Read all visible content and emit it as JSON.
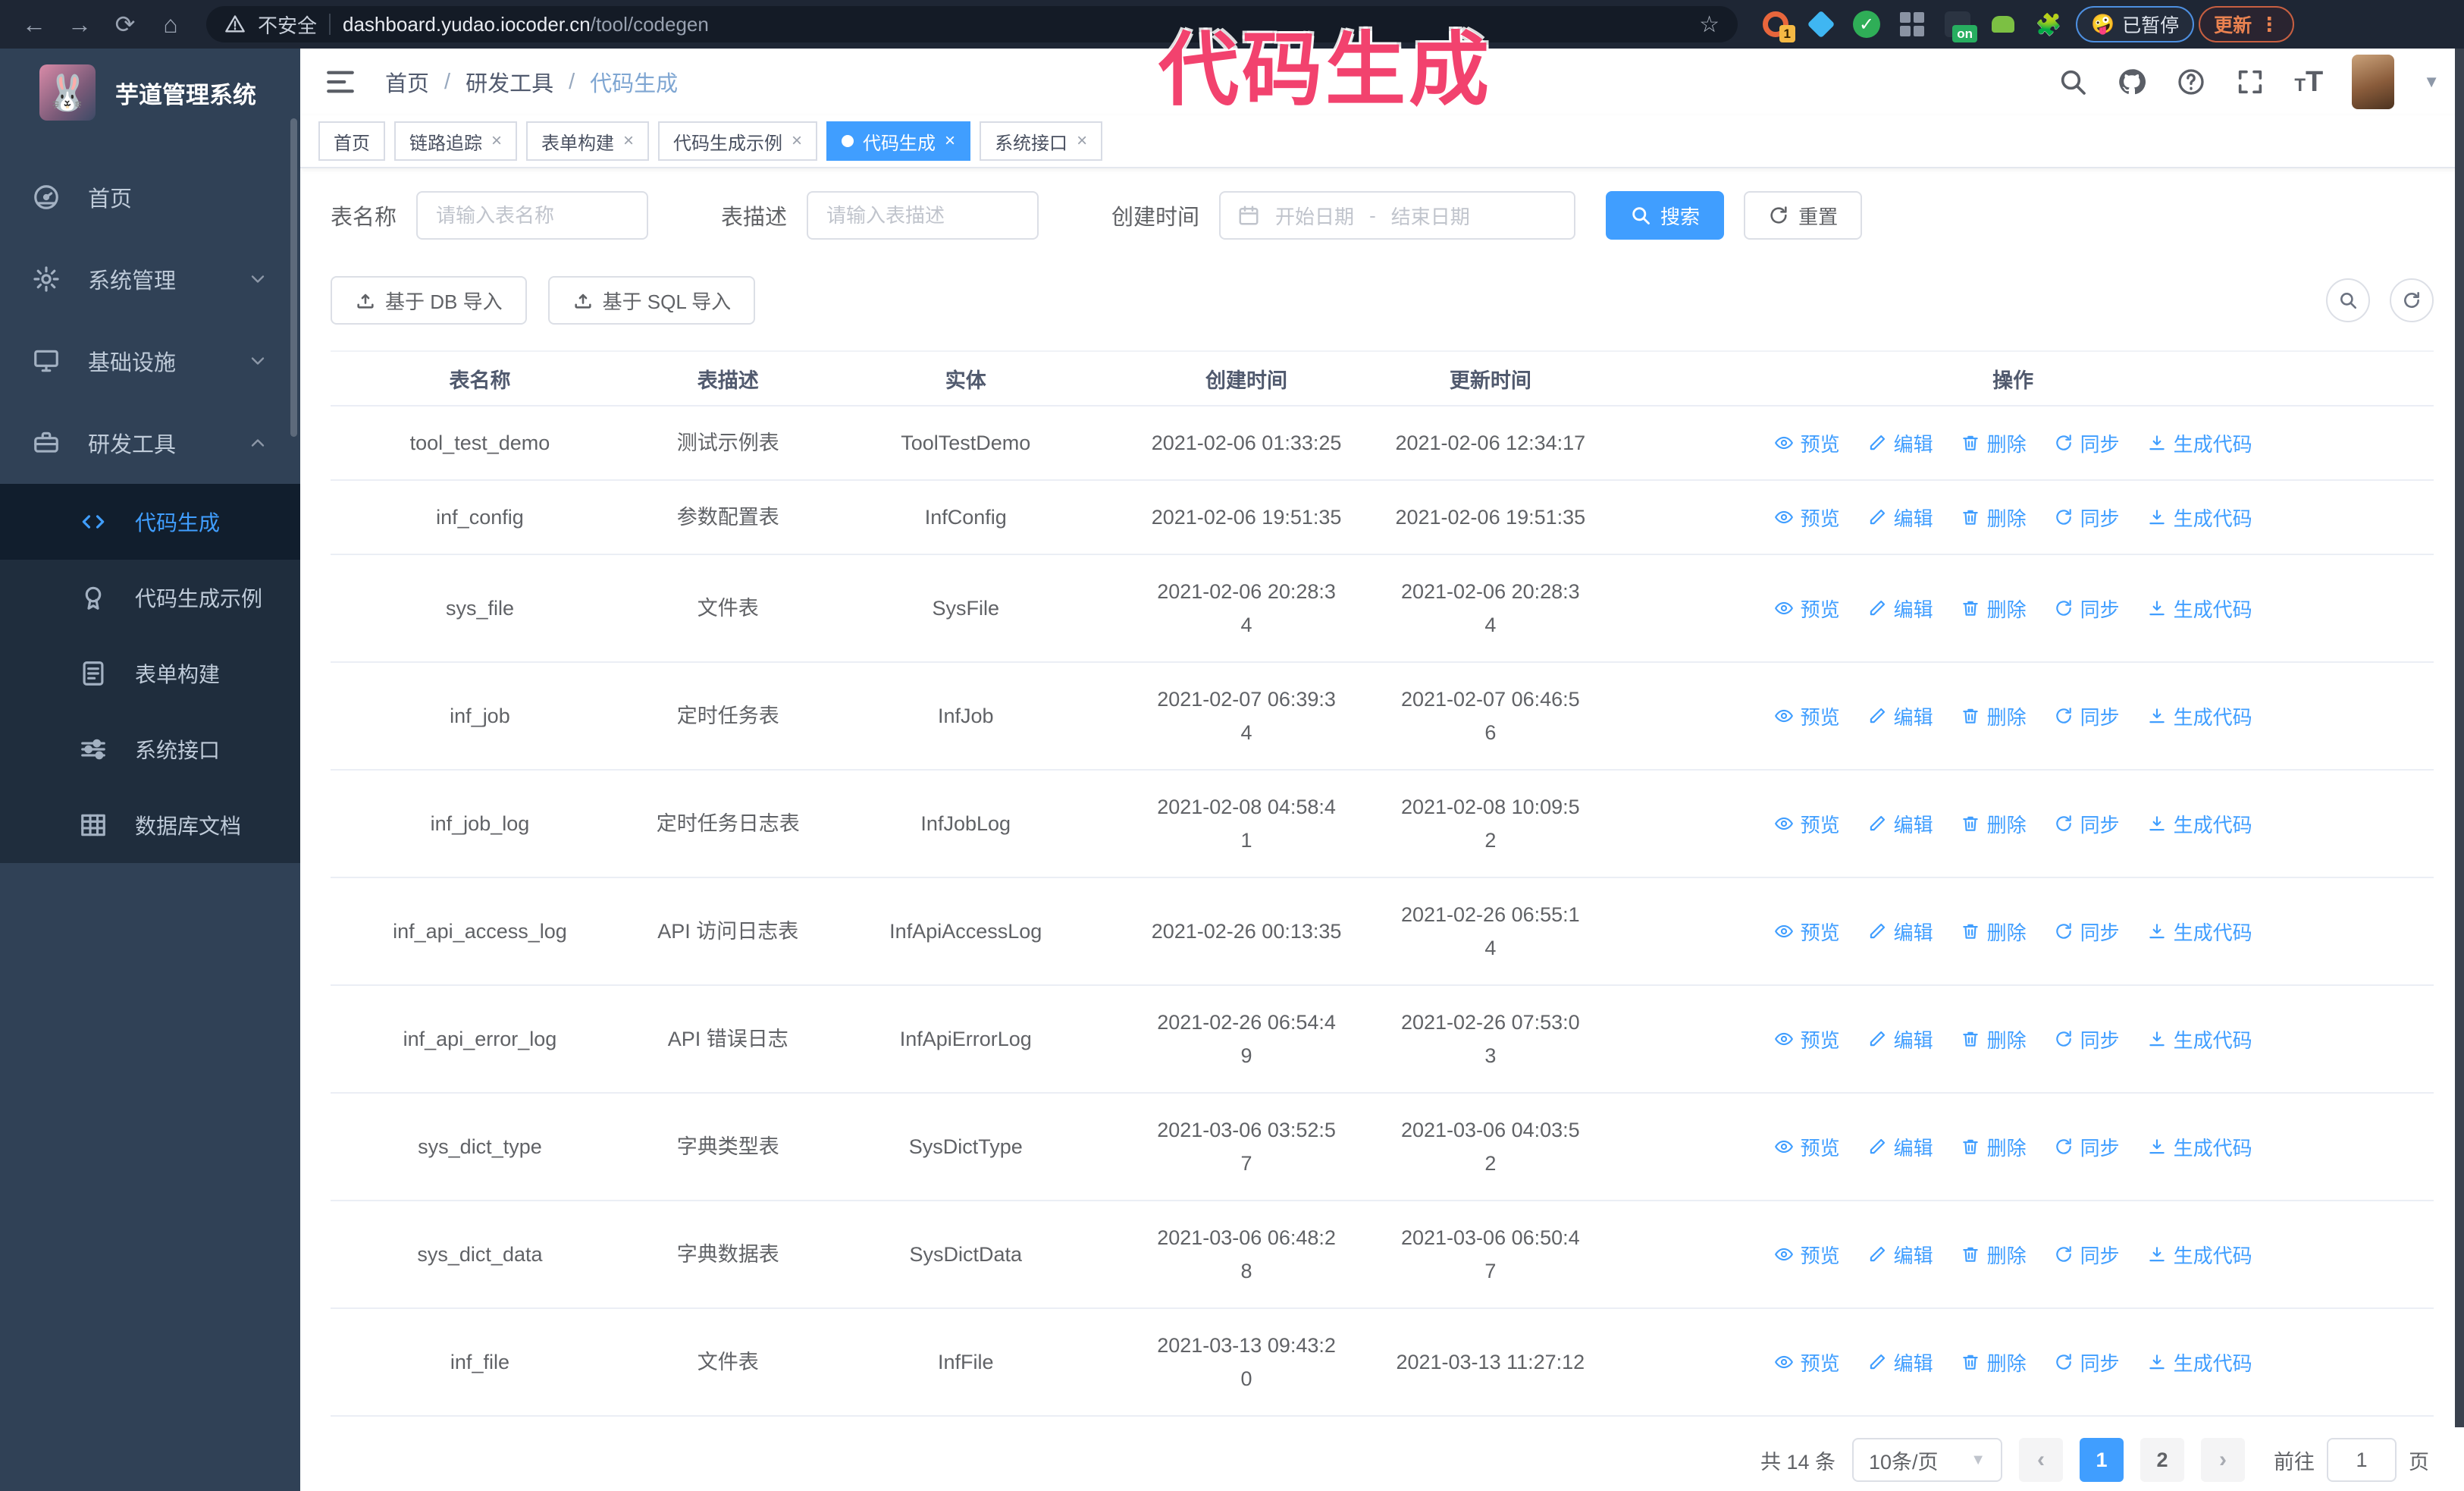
{
  "colors": {
    "accent": "#409EFF",
    "sidebar_bg": "#304156",
    "submenu_bg": "#1f2d3d",
    "chrome_bg": "#1e2634",
    "annotation_pink": "#f2426e",
    "active_tab_bg": "#409EFF"
  },
  "annotation_text": "代码生成",
  "browser": {
    "security_label": "不安全",
    "url_host": "dashboard.yudao.iocoder.cn",
    "url_path": "/tool/codegen",
    "extension_badge_count": "1",
    "extension_on_badge": "on",
    "paused_chip": "已暂停",
    "paused_emoji": "🤪",
    "update_chip": "更新",
    "update_dots": "⋮"
  },
  "sidebar": {
    "title": "芋道管理系统",
    "logo_emoji": "🐰",
    "items": [
      {
        "label": "首页",
        "icon": "home-icon",
        "group": false
      },
      {
        "label": "系统管理",
        "icon": "gear-icon",
        "group": true,
        "chevron": "down"
      },
      {
        "label": "基础设施",
        "icon": "infra-icon",
        "group": true,
        "chevron": "down"
      },
      {
        "label": "研发工具",
        "icon": "tools-icon",
        "group": true,
        "chevron": "up",
        "children": [
          {
            "label": "代码生成",
            "icon": "code-icon",
            "active": true
          },
          {
            "label": "代码生成示例",
            "icon": "example-icon",
            "active": false
          },
          {
            "label": "表单构建",
            "icon": "form-icon",
            "active": false
          },
          {
            "label": "系统接口",
            "icon": "api-icon",
            "active": false
          },
          {
            "label": "数据库文档",
            "icon": "dbdoc-icon",
            "active": false
          }
        ]
      }
    ]
  },
  "breadcrumb": [
    "首页",
    "研发工具",
    "代码生成"
  ],
  "tabs": [
    {
      "label": "首页",
      "closable": false,
      "active": false
    },
    {
      "label": "链路追踪",
      "closable": true,
      "active": false
    },
    {
      "label": "表单构建",
      "closable": true,
      "active": false
    },
    {
      "label": "代码生成示例",
      "closable": true,
      "active": false
    },
    {
      "label": "代码生成",
      "closable": true,
      "active": true
    },
    {
      "label": "系统接口",
      "closable": true,
      "active": false
    }
  ],
  "filters": {
    "name_label": "表名称",
    "name_placeholder": "请输入表名称",
    "desc_label": "表描述",
    "desc_placeholder": "请输入表描述",
    "time_label": "创建时间",
    "start_placeholder": "开始日期",
    "range_separator": "-",
    "end_placeholder": "结束日期",
    "search_label": "搜索",
    "reset_label": "重置"
  },
  "toolbar": {
    "import_db_label": "基于 DB 导入",
    "import_sql_label": "基于 SQL 导入"
  },
  "table": {
    "columns": [
      "表名称",
      "表描述",
      "实体",
      "创建时间",
      "更新时间",
      "操作"
    ],
    "actions": [
      "预览",
      "编辑",
      "删除",
      "同步",
      "生成代码"
    ],
    "rows": [
      {
        "name": "tool_test_demo",
        "desc": "测试示例表",
        "entity": "ToolTestDemo",
        "created": [
          "2021-02-06 01:33:25"
        ],
        "updated": [
          "2021-02-06 12:34:17"
        ]
      },
      {
        "name": "inf_config",
        "desc": "参数配置表",
        "entity": "InfConfig",
        "created": [
          "2021-02-06 19:51:35"
        ],
        "updated": [
          "2021-02-06 19:51:35"
        ]
      },
      {
        "name": "sys_file",
        "desc": "文件表",
        "entity": "SysFile",
        "created": [
          "2021-02-06 20:28:3",
          "4"
        ],
        "updated": [
          "2021-02-06 20:28:3",
          "4"
        ]
      },
      {
        "name": "inf_job",
        "desc": "定时任务表",
        "entity": "InfJob",
        "created": [
          "2021-02-07 06:39:3",
          "4"
        ],
        "updated": [
          "2021-02-07 06:46:5",
          "6"
        ]
      },
      {
        "name": "inf_job_log",
        "desc": "定时任务日志表",
        "entity": "InfJobLog",
        "created": [
          "2021-02-08 04:58:4",
          "1"
        ],
        "updated": [
          "2021-02-08 10:09:5",
          "2"
        ]
      },
      {
        "name": "inf_api_access_log",
        "desc": "API 访问日志表",
        "entity": "InfApiAccessLog",
        "created": [
          "2021-02-26 00:13:35"
        ],
        "updated": [
          "2021-02-26 06:55:1",
          "4"
        ]
      },
      {
        "name": "inf_api_error_log",
        "desc": "API 错误日志",
        "entity": "InfApiErrorLog",
        "created": [
          "2021-02-26 06:54:4",
          "9"
        ],
        "updated": [
          "2021-02-26 07:53:0",
          "3"
        ]
      },
      {
        "name": "sys_dict_type",
        "desc": "字典类型表",
        "entity": "SysDictType",
        "created": [
          "2021-03-06 03:52:5",
          "7"
        ],
        "updated": [
          "2021-03-06 04:03:5",
          "2"
        ]
      },
      {
        "name": "sys_dict_data",
        "desc": "字典数据表",
        "entity": "SysDictData",
        "created": [
          "2021-03-06 06:48:2",
          "8"
        ],
        "updated": [
          "2021-03-06 06:50:4",
          "7"
        ]
      },
      {
        "name": "inf_file",
        "desc": "文件表",
        "entity": "InfFile",
        "created": [
          "2021-03-13 09:43:2",
          "0"
        ],
        "updated": [
          "2021-03-13 11:27:12"
        ]
      }
    ]
  },
  "pagination": {
    "total_label": "共 14 条",
    "page_size_label": "10条/页",
    "prev_label": "‹",
    "next_label": "›",
    "pages": [
      "1",
      "2"
    ],
    "active_page": "1",
    "goto_label": "前往",
    "goto_value": "1",
    "goto_suffix": "页"
  }
}
